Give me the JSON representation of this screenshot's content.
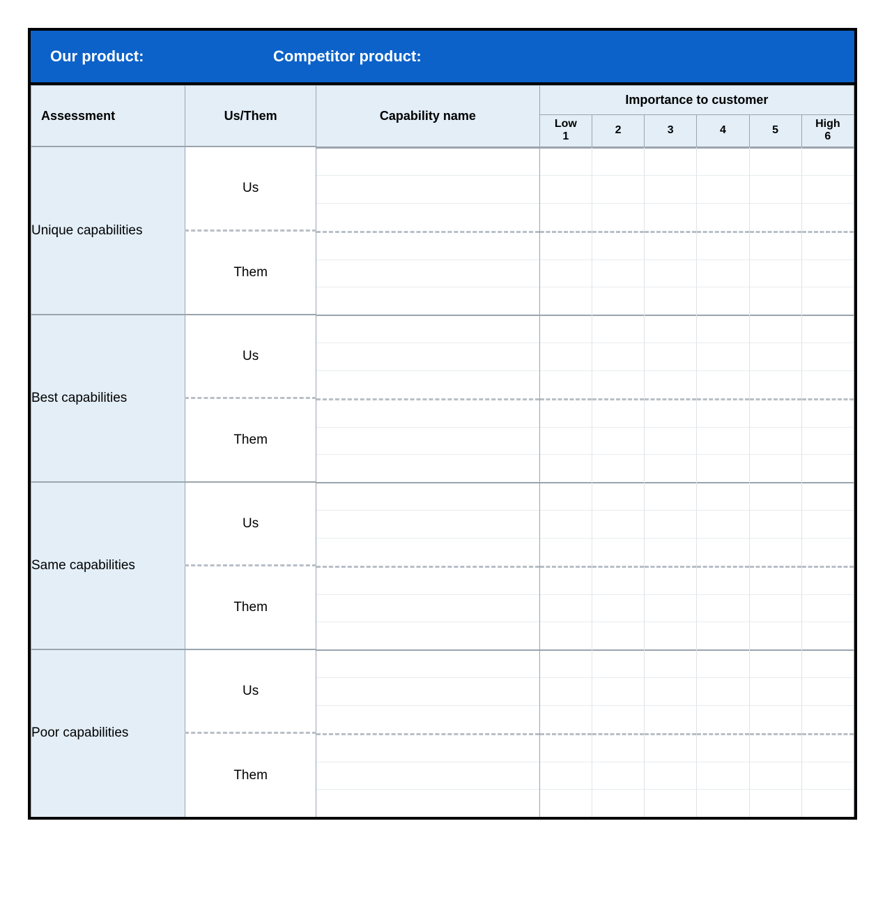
{
  "banner": {
    "our_label": "Our product:",
    "competitor_label": "Competitor product:"
  },
  "headers": {
    "assessment": "Assessment",
    "us_them": "Us/Them",
    "capability": "Capability name",
    "importance": "Importance to customer",
    "scale": [
      {
        "top": "Low",
        "bottom": "1"
      },
      {
        "top": "",
        "bottom": "2"
      },
      {
        "top": "",
        "bottom": "3"
      },
      {
        "top": "",
        "bottom": "4"
      },
      {
        "top": "",
        "bottom": "5"
      },
      {
        "top": "High",
        "bottom": "6"
      }
    ]
  },
  "party": {
    "us": "Us",
    "them": "Them"
  },
  "assessments": [
    "Unique capabilities",
    "Best capabilities",
    "Same capabilities",
    "Poor capabilities"
  ]
}
